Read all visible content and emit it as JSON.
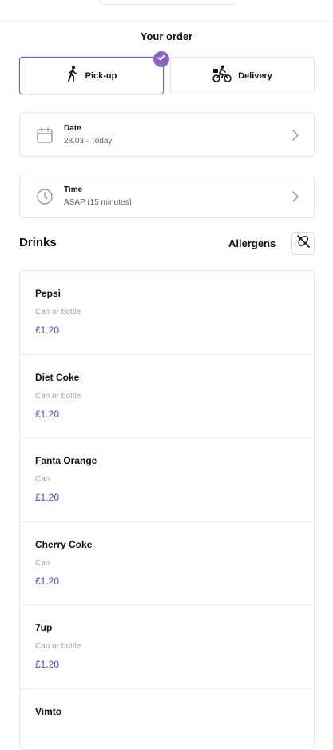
{
  "order": {
    "title": "Your order",
    "pickup_label": "Pick-up",
    "delivery_label": "Delivery",
    "selected_mode": "pickup"
  },
  "date": {
    "label": "Date",
    "value": "28.03 - Today"
  },
  "time": {
    "label": "Time",
    "value": "ASAP (15 minutes)"
  },
  "section": {
    "title": "Drinks",
    "allergens_label": "Allergens"
  },
  "items": [
    {
      "name": "Pepsi",
      "desc": "Can or bottle",
      "price": "£1.20"
    },
    {
      "name": "Diet Coke",
      "desc": "Can or bottle",
      "price": "£1.20"
    },
    {
      "name": "Fanta Orange",
      "desc": "Can",
      "price": "£1.20"
    },
    {
      "name": "Cherry Coke",
      "desc": "Can",
      "price": "£1.20"
    },
    {
      "name": "7up",
      "desc": "Can or bottle",
      "price": "£1.20"
    },
    {
      "name": "Vimto",
      "desc": "",
      "price": ""
    }
  ],
  "colors": {
    "accent": "#8a63c4",
    "price": "#6b3fb2",
    "border": "#e6e6e6",
    "muted_text": "#a0a0a0"
  },
  "icons": {
    "pickup": "walking-person-icon",
    "delivery": "bicycle-courier-icon",
    "selected": "check-icon",
    "date": "calendar-icon",
    "time": "clock-icon",
    "chevron": "chevron-right-icon",
    "allergens": "allergens-icon"
  }
}
